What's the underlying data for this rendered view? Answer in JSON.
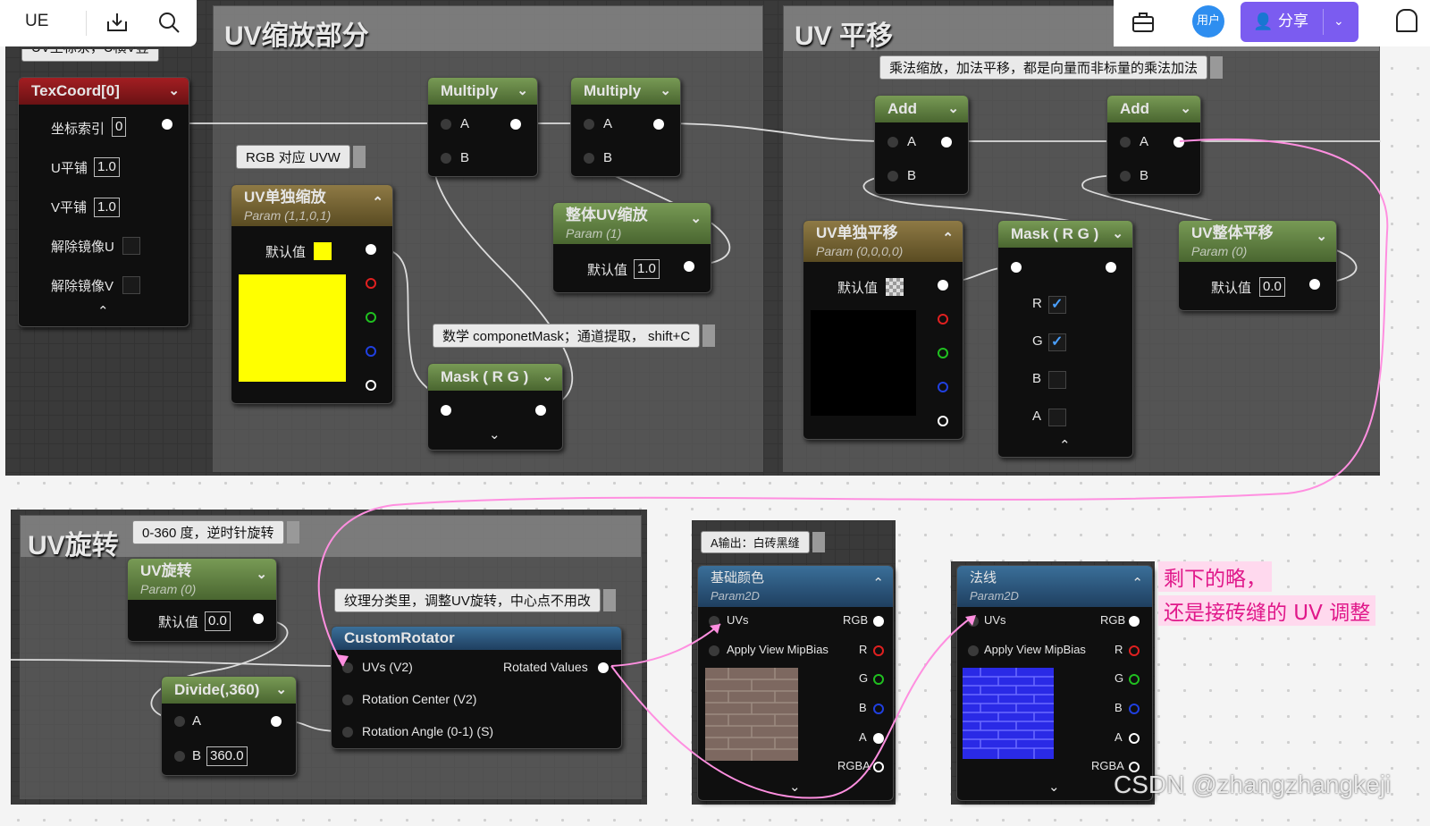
{
  "topbar": {
    "logo": "UE",
    "download_icon": "download-icon",
    "search_icon": "search-icon",
    "toolbox_icon": "toolbox-icon",
    "user_label": "用户",
    "share_label": "分享",
    "bell_icon": "bell-icon"
  },
  "comments": {
    "uv_scale": "UV缩放部分",
    "uv_translate": "UV 平移",
    "uv_rotate": "UV旋转",
    "top_left_partial": "UV坐标系，U横V竖"
  },
  "notes": {
    "rgb_uvw": "RGB 对应 UVW",
    "component_mask": "数学 componetMask；通道提取， shift+C",
    "mul_add": "乘法缩放，加法平移，都是向量而非标量的乘法加法",
    "rotate_range": "0-360 度，逆时针旋转",
    "texture_rotator": "纹理分类里，调整UV旋转，中心点不用改",
    "a_output": "A输出：白砖黑缝"
  },
  "texcoord": {
    "title": "TexCoord[0]",
    "rows": [
      {
        "label": "坐标索引",
        "value": "0"
      },
      {
        "label": "U平铺",
        "value": "1.0"
      },
      {
        "label": "V平铺",
        "value": "1.0"
      },
      {
        "label": "解除镜像U",
        "value": ""
      },
      {
        "label": "解除镜像V",
        "value": ""
      }
    ]
  },
  "multiply1": {
    "title": "Multiply",
    "a": "A",
    "b": "B"
  },
  "multiply2": {
    "title": "Multiply",
    "a": "A",
    "b": "B"
  },
  "uv_single_scale": {
    "title": "UV单独缩放",
    "sub": "Param (1,1,0,1)",
    "default_label": "默认值",
    "color": "#ffff00"
  },
  "uv_total_scale": {
    "title": "整体UV缩放",
    "sub": "Param (1)",
    "default_label": "默认值",
    "value": "1.0"
  },
  "mask1": {
    "title": "Mask ( R G )"
  },
  "add1": {
    "title": "Add",
    "a": "A",
    "b": "B"
  },
  "add2": {
    "title": "Add",
    "a": "A",
    "b": "B"
  },
  "uv_single_translate": {
    "title": "UV单独平移",
    "sub": "Param (0,0,0,0)",
    "default_label": "默认值"
  },
  "mask2": {
    "title": "Mask ( R G )",
    "r": "R",
    "g": "G",
    "b": "B",
    "a": "A",
    "r_checked": true,
    "g_checked": true,
    "b_checked": false,
    "a_checked": false
  },
  "uv_total_translate": {
    "title": "UV整体平移",
    "sub": "Param (0)",
    "default_label": "默认值",
    "value": "0.0"
  },
  "uv_rotate_param": {
    "title": "UV旋转",
    "sub": "Param (0)",
    "default_label": "默认值",
    "value": "0.0"
  },
  "divide": {
    "title": "Divide(,360)",
    "a": "A",
    "b": "B",
    "b_value": "360.0"
  },
  "custom_rotator": {
    "title": "CustomRotator",
    "in1": "UVs (V2)",
    "in2": "Rotation Center (V2)",
    "in3": "Rotation Angle (0-1) (S)",
    "out": "Rotated Values"
  },
  "base_color": {
    "title": "基础颜色",
    "sub": "Param2D",
    "uvs": "UVs",
    "mip": "Apply View MipBias",
    "rgba": [
      "RGB",
      "R",
      "G",
      "B",
      "A",
      "RGBA"
    ]
  },
  "normal": {
    "title": "法线",
    "sub": "Param2D",
    "uvs": "UVs",
    "mip": "Apply View MipBias",
    "rgba": [
      "RGB",
      "R",
      "G",
      "B",
      "A",
      "RGBA"
    ]
  },
  "remark": {
    "line1": "剩下的略，",
    "line2": "还是接砖缝的 UV 调整"
  },
  "watermark": "CSDN @zhangzhangkeji",
  "colors": {
    "pink_wire": "#ff8fe0",
    "accent": "#7b5cf0",
    "node_green": "#6a8a48",
    "node_blue": "#3a6f99"
  }
}
